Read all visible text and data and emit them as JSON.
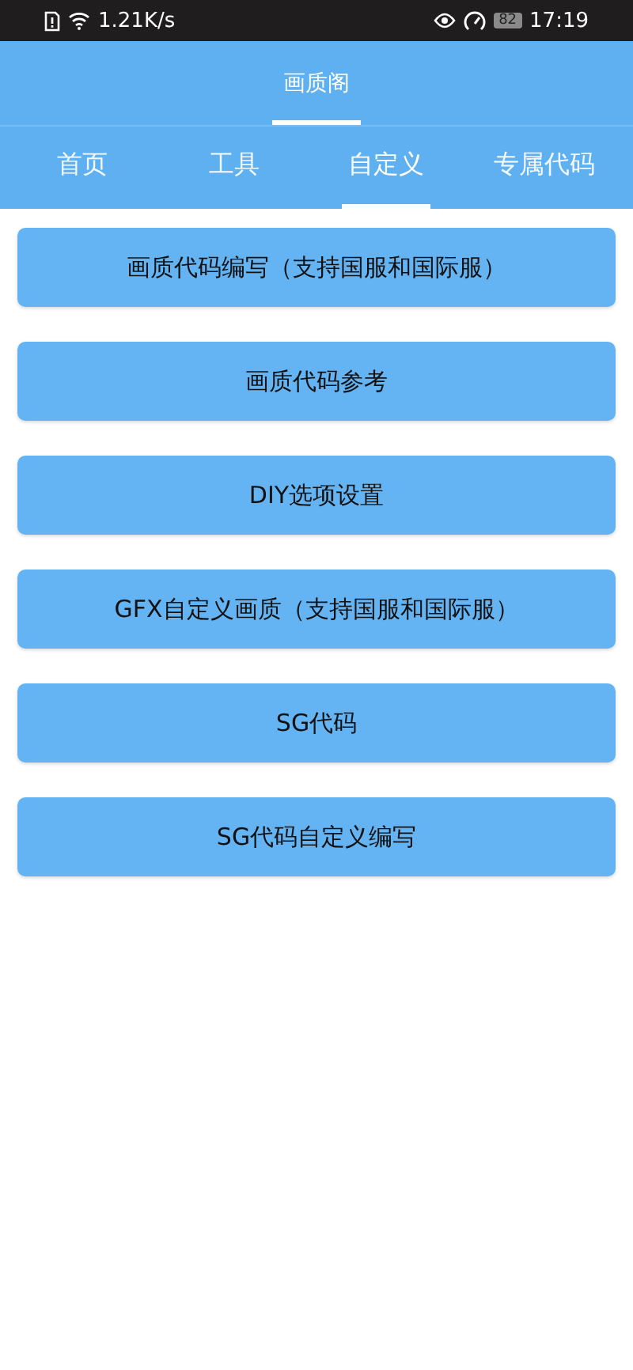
{
  "status_bar": {
    "speed": "1.21K/s",
    "battery": "82",
    "time": "17:19"
  },
  "top_tabs": [
    {
      "label": "画质阁",
      "selected": true
    }
  ],
  "tabs": [
    {
      "label": "首页",
      "selected": false
    },
    {
      "label": "工具",
      "selected": false
    },
    {
      "label": "自定义",
      "selected": true
    },
    {
      "label": "专属代码",
      "selected": false
    }
  ],
  "buttons": [
    "画质代码编写（支持国服和国际服）",
    "画质代码参考",
    "DIY选项设置",
    "GFX自定义画质（支持国服和国际服）",
    "SG代码",
    "SG代码自定义编写"
  ]
}
